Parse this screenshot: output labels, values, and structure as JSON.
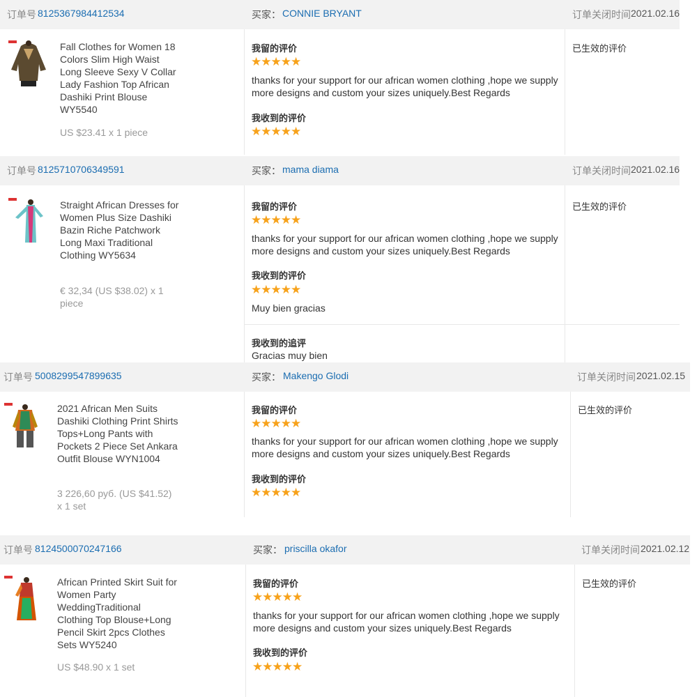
{
  "labels": {
    "order_no": "订单号",
    "buyer": "买家：",
    "closed_time": "订单关闭时间",
    "my_feedback": "我留的评价",
    "received_feedback": "我收到的评价",
    "received_followup": "我收到的追评",
    "status_effective": "已生效的评价"
  },
  "accent_color": "#1b6db1",
  "star_color": "#f7a21b",
  "orders": [
    {
      "order_id": "8125367984412534",
      "buyer": "CONNIE BRYANT",
      "closed_date": "2021.02.16",
      "product_title": "Fall Clothes for Women 18 Colors Slim High Waist Long Sleeve Sexy V Collar Lady Fashion Top African Dashiki Print Blouse WY5540",
      "price": "US $23.41 x 1 piece",
      "my_stars": "★★★★★",
      "my_feedback": "thanks for your support for our african women clothing ,hope we supply more designs and custom your sizes uniquely.Best Regards",
      "received_stars": "★★★★★",
      "received_comment": "",
      "followup": ""
    },
    {
      "order_id": "8125710706349591",
      "buyer": "mama diama",
      "closed_date": "2021.02.16",
      "product_title": "Straight African Dresses for Women Plus Size Dashiki Bazin Riche Patchwork Long Maxi Traditional Clothing WY5634",
      "price": "€ 32,34 (US $38.02) x 1 piece",
      "my_stars": "★★★★★",
      "my_feedback": "thanks for your support for our african women clothing ,hope we supply more designs and custom your sizes uniquely.Best Regards",
      "received_stars": "★★★★★",
      "received_comment": "Muy bien gracias",
      "followup": "Gracias muy bien"
    },
    {
      "order_id": "5008299547899635",
      "buyer": "Makengo Glodi",
      "closed_date": "2021.02.15",
      "product_title": "2021 African Men Suits Dashiki Clothing Print Shirts Tops+Long Pants with Pockets 2 Piece Set Ankara Outfit Blouse WYN1004",
      "price": "3 226,60 руб. (US $41.52) x 1 set",
      "my_stars": "★★★★★",
      "my_feedback": "thanks for your support for our african women clothing ,hope we supply more designs and custom your sizes uniquely.Best Regards",
      "received_stars": "★★★★★",
      "received_comment": "",
      "followup": ""
    },
    {
      "order_id": "8124500070247166",
      "buyer": "priscilla okafor",
      "closed_date": "2021.02.12",
      "product_title": "African Printed Skirt Suit for Women Party WeddingTraditional Clothing Top Blouse+Long Pencil Skirt 2pcs Clothes Sets WY5240",
      "price": "US $48.90 x 1 set",
      "my_stars": "★★★★★",
      "my_feedback": "thanks for your support for our african women clothing ,hope we supply more designs and custom your sizes uniquely.Best Regards",
      "received_stars": "★★★★★",
      "received_comment": "",
      "followup": ""
    }
  ]
}
